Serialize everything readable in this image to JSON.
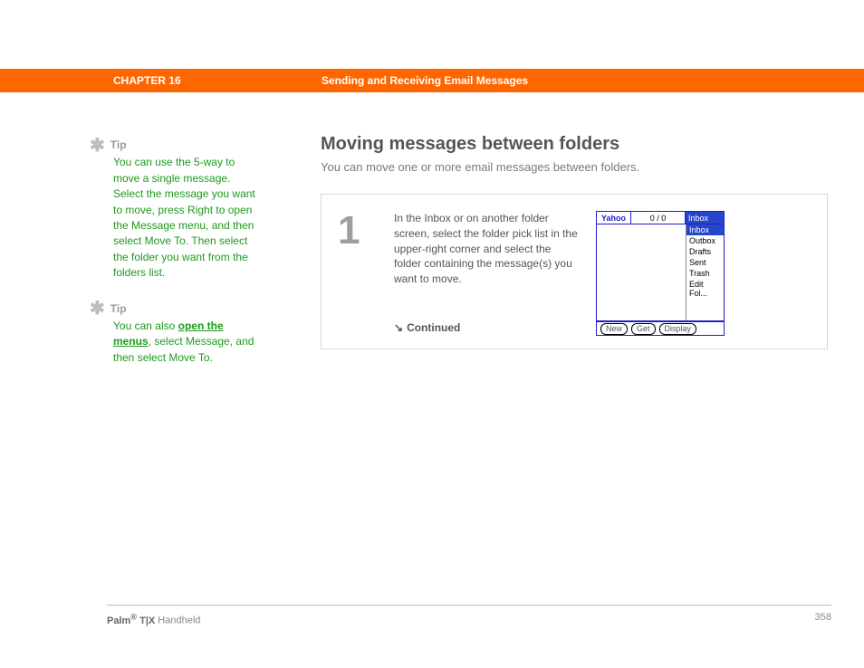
{
  "header": {
    "chapter": "CHAPTER 16",
    "title": "Sending and Receiving Email Messages"
  },
  "sidebar": {
    "tip1_label": "Tip",
    "tip1_body": "You can use the 5-way to move a single message. Select the message you want to move, press Right to open the Message menu, and then select Move To. Then select the folder you want from the folders list.",
    "tip2_label": "Tip",
    "tip2_pre": "You can also ",
    "tip2_link": "open the menus",
    "tip2_post": ", select Message, and then select Move To."
  },
  "main": {
    "heading": "Moving messages between folders",
    "intro": "You can move one or more email messages between folders.",
    "step_number": "1",
    "step_text": "In the Inbox or on another folder screen, select the folder pick list in the upper-right corner and select the folder containing the message(s) you want to move.",
    "continued": "Continued"
  },
  "device": {
    "account": "Yahoo",
    "counter": "0 / 0",
    "selected_folder": "Inbox",
    "folders": [
      "Inbox",
      "Outbox",
      "Drafts",
      "Sent",
      "Trash",
      "Edit Fol..."
    ],
    "buttons": {
      "new": "New",
      "get": "Get",
      "display": "Display"
    }
  },
  "footer": {
    "brand_pre": "Palm",
    "brand_reg": "®",
    "brand_model": " T|X",
    "brand_post": " Handheld",
    "page": "358"
  }
}
